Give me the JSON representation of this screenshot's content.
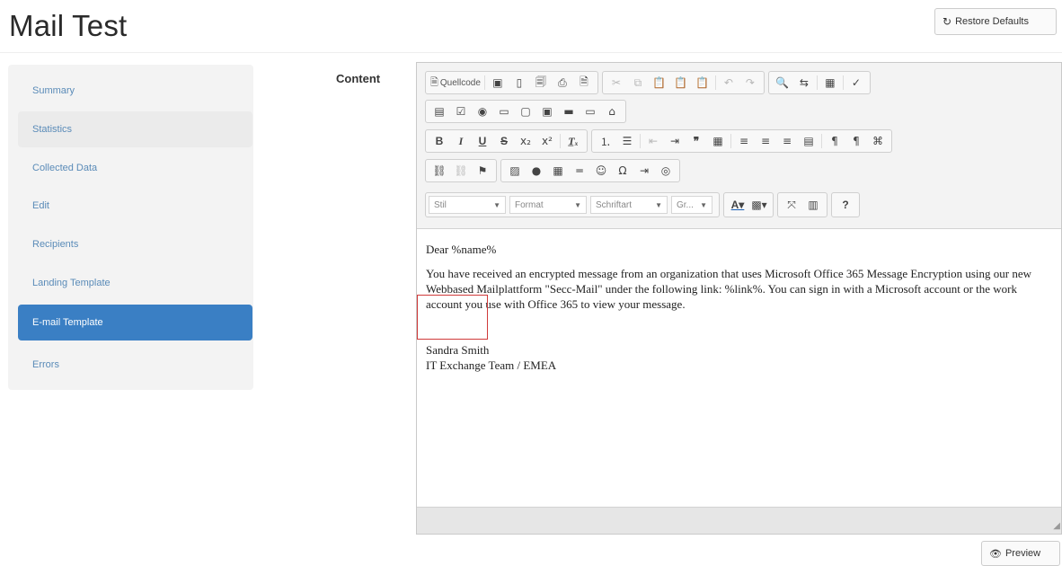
{
  "page": {
    "title": "Mail Test",
    "restore_label": "Restore Defaults",
    "preview_label": "Preview",
    "content_label": "Content"
  },
  "sidebar": {
    "items": [
      {
        "label": "Summary",
        "state": "normal"
      },
      {
        "label": "Statistics",
        "state": "hover"
      },
      {
        "label": "Collected Data",
        "state": "normal"
      },
      {
        "label": "Edit",
        "state": "normal"
      },
      {
        "label": "Recipients",
        "state": "normal"
      },
      {
        "label": "Landing Template",
        "state": "normal"
      },
      {
        "label": "E-mail Template",
        "state": "active"
      },
      {
        "label": "Errors",
        "state": "normal"
      }
    ]
  },
  "editor": {
    "source_label": "Quellcode",
    "combos": {
      "style": "Stil",
      "format": "Format",
      "font": "Schriftart",
      "size": "Gr..."
    },
    "body": {
      "greeting": "Dear %name%",
      "paragraph": "You have received an encrypted message from an organization that uses Microsoft Office 365 Message Encryption using our new Webbased Mailplattform \"Secc-Mail\" under the following link: %link%. You can sign in with a Microsoft account or the work account you use with Office 365 to view your message.",
      "signature_name": "Sandra Smith",
      "signature_team": "IT Exchange Team / EMEA"
    }
  },
  "colors": {
    "active_nav": "#3a7fc4",
    "nav_link": "#5a8bb8",
    "highlight_border": "#d03a3a"
  }
}
